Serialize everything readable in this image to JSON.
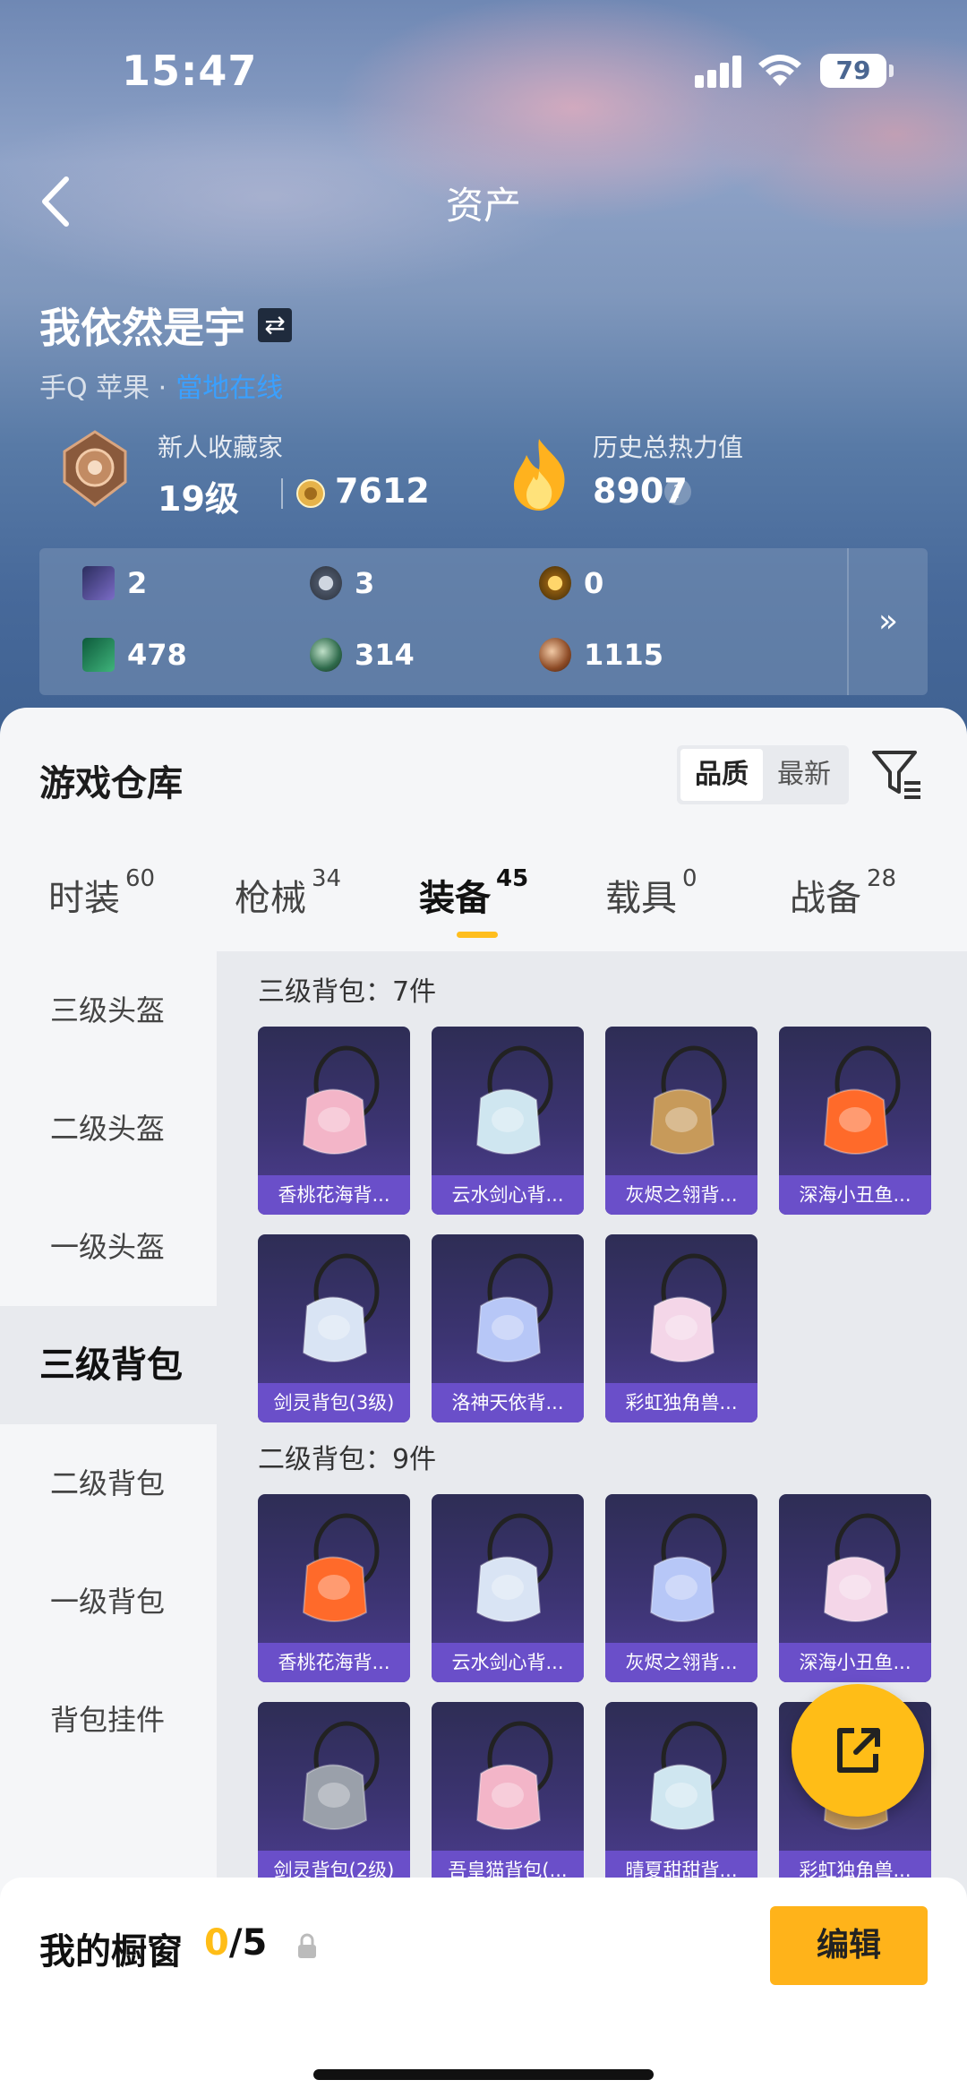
{
  "status_bar": {
    "time": "15:47",
    "battery": "79"
  },
  "header": {
    "title": "资产"
  },
  "profile": {
    "username": "我依然是宇",
    "platform": "手Q 苹果 ·",
    "status": "當地在线",
    "collector_title": "新人收藏家",
    "level": "19级",
    "coins": "7612",
    "heat_label": "历史总热力值",
    "heat_value": "8907"
  },
  "stats": [
    {
      "icon": "card-icon",
      "value": "2"
    },
    {
      "icon": "badge-s-icon",
      "value": "3"
    },
    {
      "icon": "badge-a-icon",
      "value": "0"
    },
    {
      "icon": "green-card-icon",
      "value": "478"
    },
    {
      "icon": "green-orb-icon",
      "value": "314"
    },
    {
      "icon": "bronze-orb-icon",
      "value": "1115"
    }
  ],
  "warehouse": {
    "title": "游戏仓库",
    "sort_options": [
      "品质",
      "最新"
    ],
    "active_sort": "品质"
  },
  "tabs": [
    {
      "label": "时装",
      "count": "60"
    },
    {
      "label": "枪械",
      "count": "34"
    },
    {
      "label": "装备",
      "count": "45"
    },
    {
      "label": "载具",
      "count": "0"
    },
    {
      "label": "战备",
      "count": "28"
    }
  ],
  "active_tab": "装备",
  "side_nav": [
    "三级头盔",
    "二级头盔",
    "一级头盔",
    "三级背包",
    "二级背包",
    "一级背包",
    "背包挂件"
  ],
  "active_side": "三级背包",
  "sections": [
    {
      "title": "三级背包：7件",
      "items": [
        "香桃花海背...",
        "云水剑心背...",
        "灰烬之翎背...",
        "深海小丑鱼...",
        "剑灵背包(3级)",
        "洛神天依背...",
        "彩虹独角兽..."
      ]
    },
    {
      "title": "二级背包：9件",
      "items": [
        "香桃花海背...",
        "云水剑心背...",
        "灰烬之翎背...",
        "深海小丑鱼...",
        "剑灵背包(2级)",
        "吾皇猫背包(...",
        "晴夏甜甜背...",
        "彩虹独角兽..."
      ]
    }
  ],
  "colors": {
    "accent": "#ffbd17",
    "item_bg": "#3c3472",
    "item_label": "#6a4fc9"
  },
  "bottom": {
    "label": "我的橱窗",
    "current": "0",
    "total": "/5",
    "edit": "编辑"
  }
}
